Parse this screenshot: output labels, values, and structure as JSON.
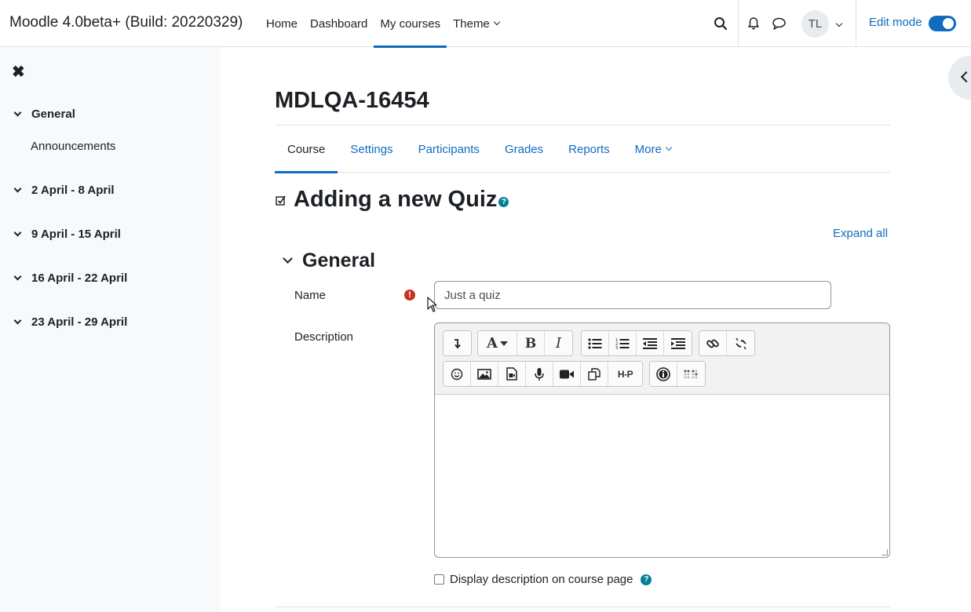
{
  "brand": "Moodle 4.0beta+ (Build: 20220329)",
  "primary_nav": [
    {
      "label": "Home"
    },
    {
      "label": "Dashboard"
    },
    {
      "label": "My courses"
    },
    {
      "label": "Theme"
    }
  ],
  "user": {
    "initials": "TL"
  },
  "edit_mode": {
    "label": "Edit mode",
    "on": true
  },
  "drawer": {
    "sections": [
      {
        "label": "General",
        "items": [
          "Announcements"
        ]
      },
      {
        "label": "2 April - 8 April"
      },
      {
        "label": "9 April - 15 April"
      },
      {
        "label": "16 April - 22 April"
      },
      {
        "label": "23 April - 29 April"
      }
    ]
  },
  "course": {
    "title": "MDLQA-16454"
  },
  "secondary_nav": [
    {
      "label": "Course"
    },
    {
      "label": "Settings"
    },
    {
      "label": "Participants"
    },
    {
      "label": "Grades"
    },
    {
      "label": "Reports"
    },
    {
      "label": "More"
    }
  ],
  "form": {
    "title": "Adding a new Quiz",
    "help_glyph": "?",
    "expand_all": "Expand all",
    "section_title": "General",
    "name_label": "Name",
    "name_value": "Just a quiz",
    "required_glyph": "!",
    "description_label": "Description",
    "display_desc_label": "Display description on course page"
  },
  "editor_toolbar": {
    "row1": [
      "collapse-icon",
      "font-style-icon",
      "bold-icon",
      "italic-icon",
      "unordered-list-icon",
      "ordered-list-icon",
      "outdent-icon",
      "indent-icon",
      "link-icon",
      "unlink-icon"
    ],
    "row2": [
      "emoji-icon",
      "image-icon",
      "media-icon",
      "record-audio-icon",
      "record-video-icon",
      "manage-files-icon",
      "h5p-icon",
      "accessibility-checker-icon",
      "screenreader-helper-icon"
    ],
    "labels": {
      "bold": "B",
      "italic": "I",
      "font": "A",
      "h5p": "H-P"
    }
  },
  "colors": {
    "accent": "#0f6cbf",
    "required": "#ca3120",
    "help": "#008196",
    "drawer_bg": "#f8f9fa"
  }
}
